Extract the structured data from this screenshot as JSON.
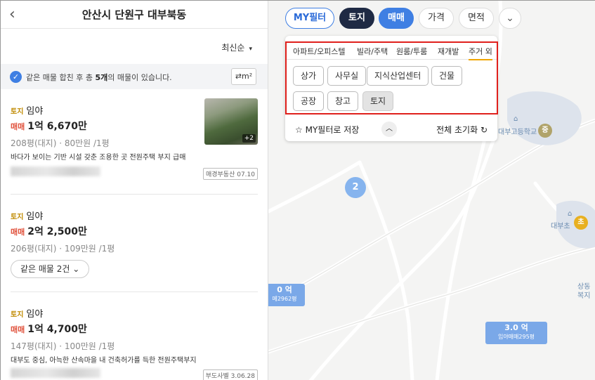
{
  "header": {
    "back_icon": "chevron-left-icon",
    "title": "안산시 단원구 대부북동"
  },
  "sort": {
    "label": "최신순",
    "arrow": "▾"
  },
  "merge": {
    "prefix": "같은 매물 합친 후 총 ",
    "count": "5개",
    "suffix": "의 매물이 있습니다.",
    "unit_label": "⇄m²"
  },
  "listings": [
    {
      "tag": "토지",
      "category": "임야",
      "deal": "매매",
      "price": "1억 6,670만",
      "area": "208평(대지) · 80만원 /1평",
      "desc": "바다가 보이는 기반 시설 갖춘 조용한 곳 전원주택 부지 급매",
      "source": "매경부동산 07.10",
      "photo_count": "+2"
    },
    {
      "tag": "토지",
      "category": "임야",
      "deal": "매매",
      "price": "2억 2,500만",
      "area": "206평(대지) · 109만원 /1평",
      "same_label": "같은 매물 2건"
    },
    {
      "tag": "토지",
      "category": "임야",
      "deal": "매매",
      "price": "1억 4,700만",
      "area": "147평(대지) · 100만원 /1평",
      "desc": "대부도 중심, 아늑한 산속마을 내 건축허가를 득한 전원주택부지",
      "source": "부도사벨 3.06.28"
    }
  ],
  "filters": {
    "my_filter": "MY필터",
    "land": "토지",
    "deal": "매매",
    "price": "가격",
    "area": "면적",
    "more_icon": "chevron-down-icon"
  },
  "dropdown": {
    "tabs": [
      "아파트/오피스텔",
      "빌라/주택",
      "원룸/투룸",
      "재개발",
      "주거 외"
    ],
    "options": [
      "상가",
      "사무실",
      "지식산업센터",
      "건물",
      "공장",
      "창고",
      "토지"
    ],
    "save_label": "MY필터로 저장",
    "reset_label": "전체 초기화"
  },
  "map": {
    "cluster": "2",
    "marker_left": {
      "value": "0 억",
      "sub": "메2962평"
    },
    "marker_right": {
      "value": "3.0 억",
      "sub": "임야매매295평"
    },
    "poi_school": "대부고등학교",
    "poi_school2": "대부초",
    "poi_edge": "상동",
    "poi_edge2": "복지",
    "badge_mid": "중",
    "badge_elem": "초"
  },
  "colors": {
    "accent": "#3f7fe3",
    "dark_chip": "#1f2a44",
    "deal_red": "#e0513b",
    "tag_gold": "#c08a00",
    "highlight": "#e0201c"
  }
}
